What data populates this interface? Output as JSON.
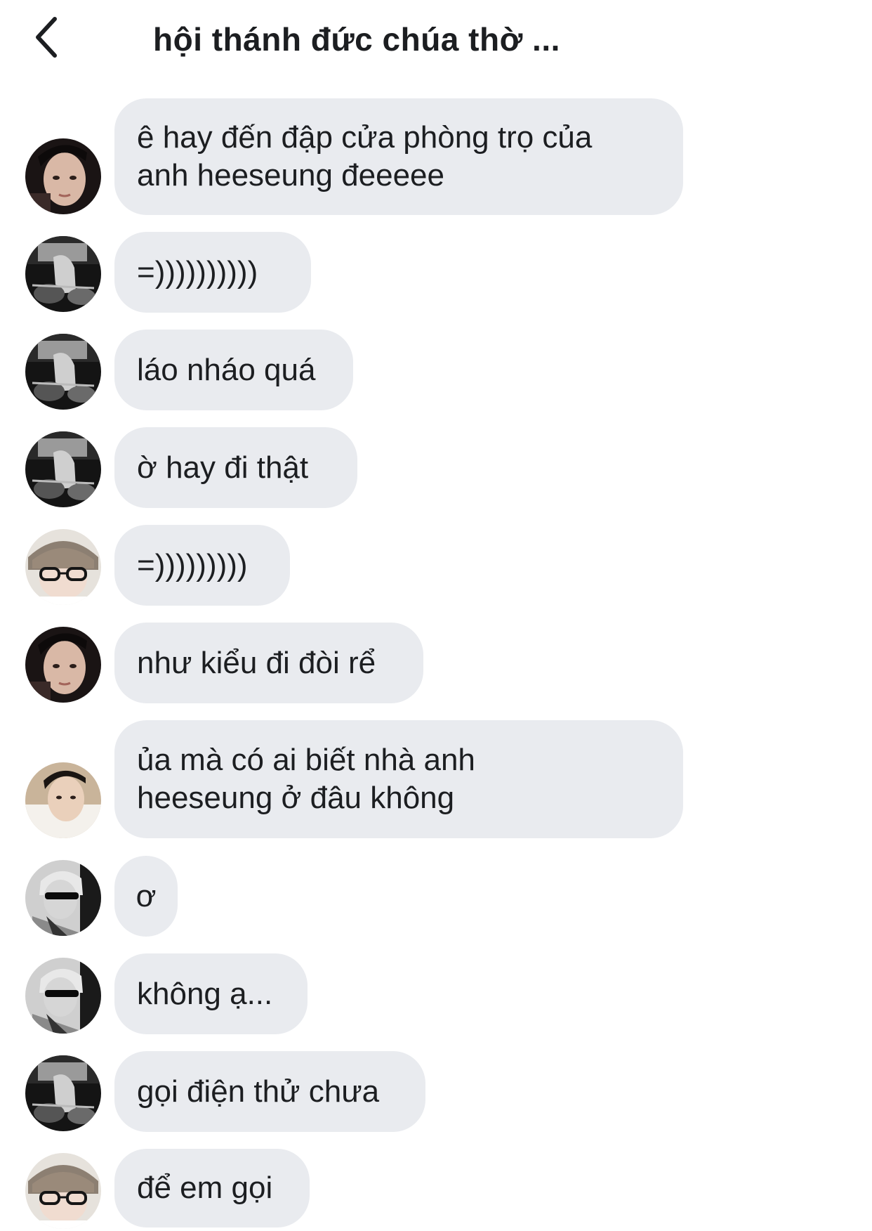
{
  "header": {
    "back_icon": "chevron-left-icon",
    "title": "hội thánh đức chúa thờ ..."
  },
  "messages": [
    {
      "text": "ê hay đến đập cửa phòng trọ của\nanh heeseung đeeeee",
      "avatar": "avatar-dark-portrait"
    },
    {
      "text": "=))))))))))",
      "avatar": "avatar-bw-motorcycle"
    },
    {
      "text": "láo nháo quá",
      "avatar": "avatar-bw-motorcycle"
    },
    {
      "text": "ờ hay đi thật",
      "avatar": "avatar-bw-motorcycle"
    },
    {
      "text": "=)))))))))",
      "avatar": "avatar-glasses"
    },
    {
      "text": "như kiểu đi đòi rể",
      "avatar": "avatar-dark-portrait"
    },
    {
      "text": "ủa mà có ai biết nhà anh\nheeseung ở đâu không",
      "avatar": "avatar-light-portrait"
    },
    {
      "text": "ơ",
      "avatar": "avatar-sunglasses"
    },
    {
      "text": "không ạ...",
      "avatar": "avatar-sunglasses"
    },
    {
      "text": "gọi điện thử chưa",
      "avatar": "avatar-bw-motorcycle"
    },
    {
      "text": "để em gọi",
      "avatar": "avatar-glasses"
    }
  ],
  "colors": {
    "bubble": "#e9ebef",
    "text": "#1c1e21",
    "background": "#ffffff"
  }
}
